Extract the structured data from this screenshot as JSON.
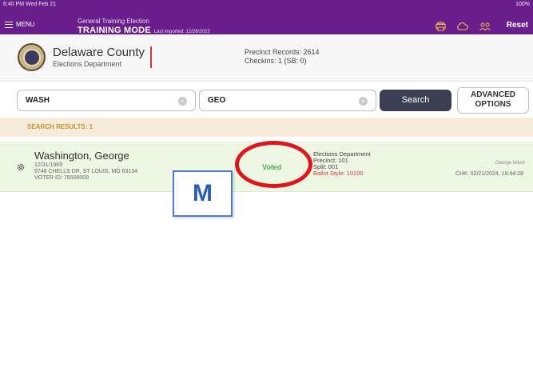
{
  "statusbar": {
    "time": "6:40 PM  Wed Feb 21",
    "battery": "100%"
  },
  "topbar": {
    "menu_label": "MENU",
    "election_name": "General Training Election",
    "mode": "TRAINING MODE",
    "last_imported": "Last imported: 12/26/2023",
    "reset_label": "Reset",
    "icons": [
      "print-icon",
      "cloud-icon",
      "users-icon"
    ],
    "background_color": "#6a1e8c"
  },
  "header": {
    "county": "Delaware County",
    "department": "Elections Department",
    "precinct_records": "Precinct Records:  2614",
    "checkins": "Checkins:  1 (SB: 0)"
  },
  "search": {
    "last_name_value": "WASH",
    "first_name_value": "GEO",
    "search_label": "Search",
    "advanced_line1": "ADVANCED",
    "advanced_line2": "OPTIONS"
  },
  "results": {
    "label": "SEARCH RESULTS: 1",
    "voters": [
      {
        "name": "Washington, George",
        "dob": "12/31/1969",
        "address": "9748 CHELLS DR, ST LOUIS, MO 63134",
        "voter_id": "VOTER ID: 76500008",
        "status": "Voted",
        "department": "Elections Department",
        "precinct": "Precinct: 101",
        "split": "Split: 001",
        "ballot_style": "Ballot Style: 10100",
        "signature": "George Wash",
        "checkin": "CHK: 02/21/2024, 18:44:28"
      }
    ]
  },
  "annotation": {
    "marker_label": "M"
  }
}
